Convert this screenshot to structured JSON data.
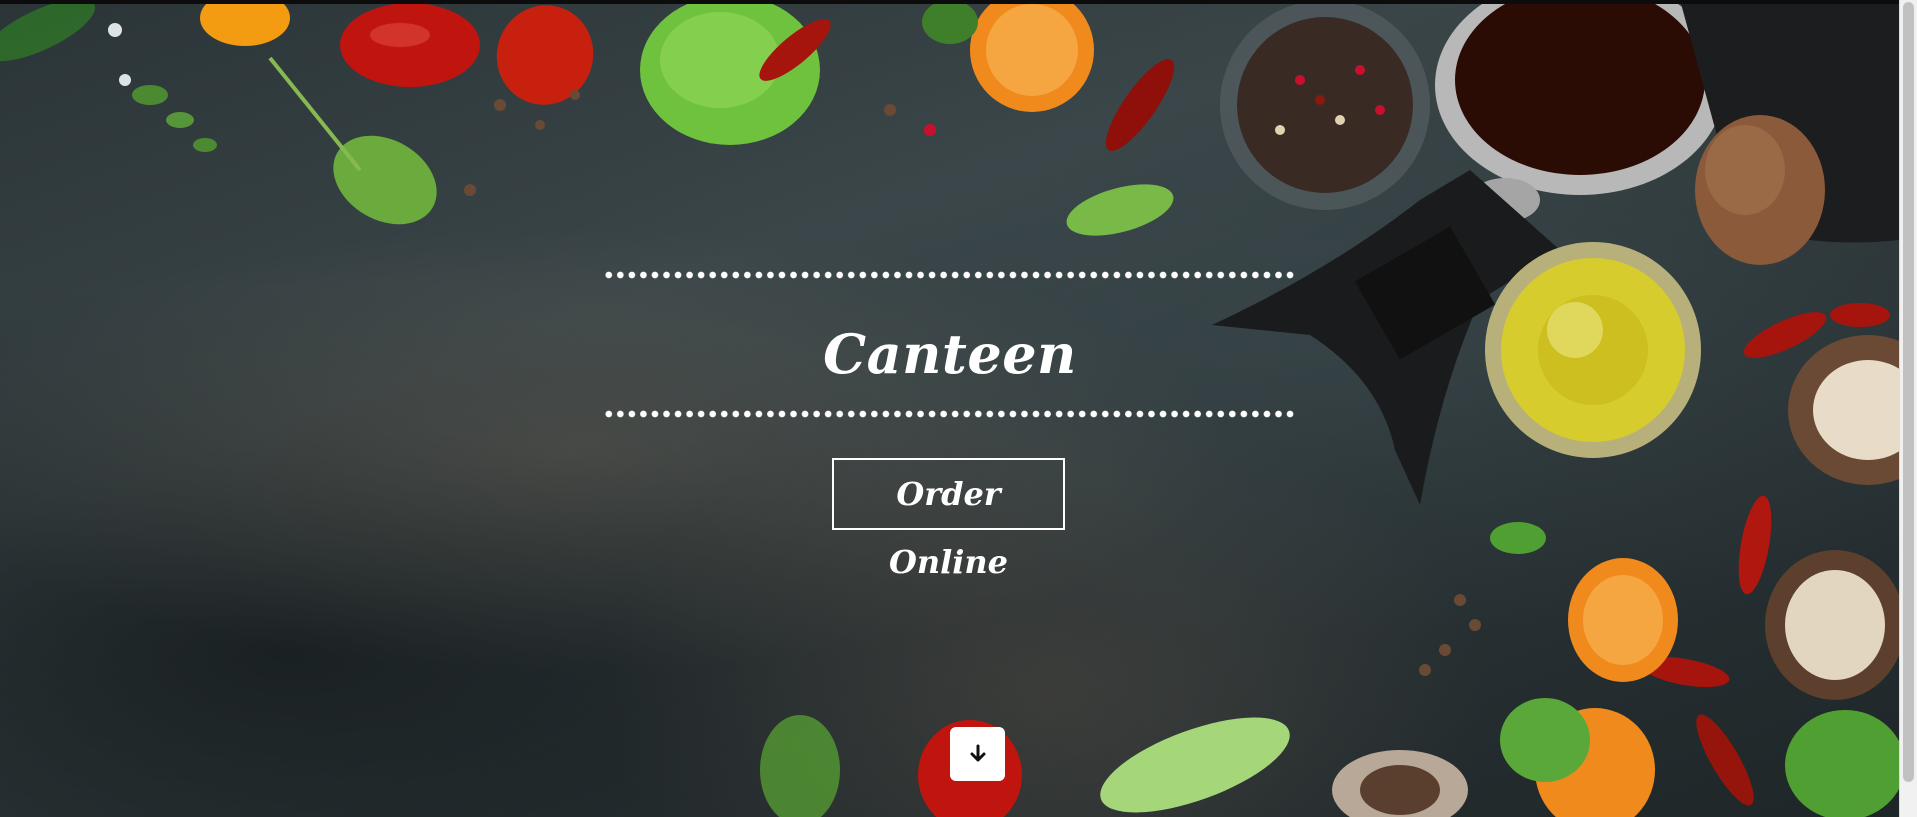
{
  "hero": {
    "title": "Canteen",
    "order_button_label": "Order Online",
    "scroll_down_icon": "arrow-down-icon"
  },
  "colors": {
    "background": "#2b3538",
    "text": "#ffffff",
    "button_border": "#ffffff",
    "scroll_button_bg": "#ffffff"
  }
}
